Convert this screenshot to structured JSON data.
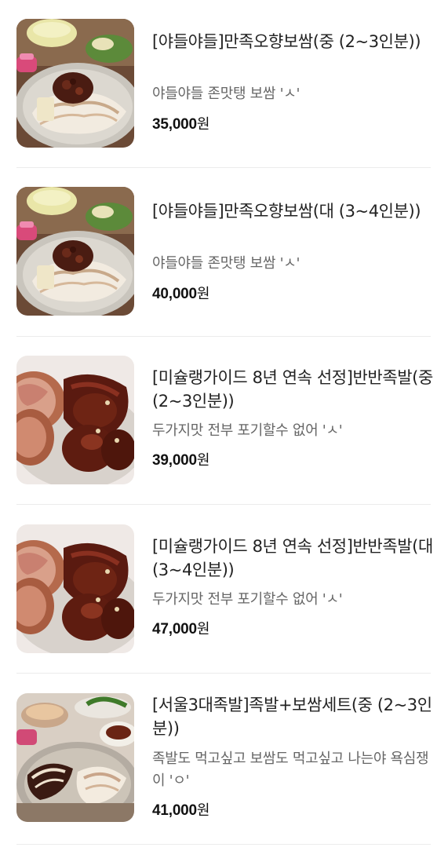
{
  "products": [
    {
      "title": "[야들야들]만족오향보쌈(중 (2~3인분))",
      "description": "야들야들 존맛탱 보쌈 'ㅅ'",
      "price": "35,000",
      "currency": "원",
      "image_icon": "bossam-photo"
    },
    {
      "title": "[야들야들]만족오향보쌈(대 (3~4인분))",
      "description": "야들야들 존맛탱 보쌈 'ㅅ'",
      "price": "40,000",
      "currency": "원",
      "image_icon": "bossam-photo"
    },
    {
      "title": "[미슐랭가이드 8년 연속 선정]반반족발(중 (2~3인분))",
      "description": "두가지맛 전부 포기할수 없어 'ㅅ'",
      "price": "39,000",
      "currency": "원",
      "image_icon": "jokbal-photo"
    },
    {
      "title": "[미슐랭가이드 8년 연속 선정]반반족발(대 (3~4인분))",
      "description": "두가지맛 전부 포기할수 없어 'ㅅ'",
      "price": "47,000",
      "currency": "원",
      "image_icon": "jokbal-photo"
    },
    {
      "title": "[서울3대족발]족발+보쌈세트(중 (2~3인분))",
      "description": "족발도 먹고싶고 보쌈도 먹고싶고 나는야 욕심쟁이 'ㅇ'",
      "price": "41,000",
      "currency": "원",
      "image_icon": "combo-photo"
    }
  ]
}
